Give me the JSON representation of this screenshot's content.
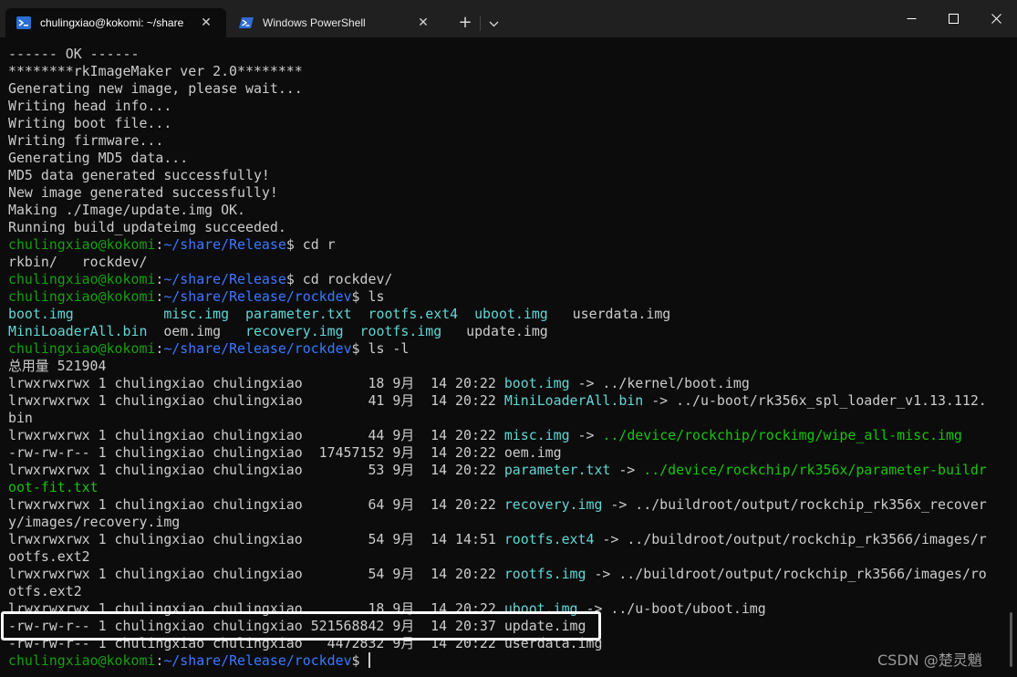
{
  "tabs": [
    {
      "label": "chulingxiao@kokomi: ~/share",
      "icon": "linux-shell-icon",
      "close": "✕"
    },
    {
      "label": "Windows PowerShell",
      "icon": "powershell-icon",
      "close": "✕"
    }
  ],
  "titlebar": {
    "new_tab": "+",
    "dropdown": "chevron-down-icon"
  },
  "window_controls": {
    "minimize": "minimize-icon",
    "maximize": "maximize-icon",
    "close": "close-icon"
  },
  "prompt": {
    "user_host": "chulingxiao@kokomi",
    "sep": ":"
  },
  "terminal": {
    "build_output": [
      "------ OK ------",
      "********rkImageMaker ver 2.0********",
      "Generating new image, please wait...",
      "Writing head info...",
      "Writing boot file...",
      "Writing firmware...",
      "Generating MD5 data...",
      "MD5 data generated successfully!",
      "New image generated successfully!",
      "Making ./Image/update.img OK.",
      "Running build_updateimg succeeded."
    ],
    "path_release": "~/share/Release",
    "path_rockdev": "~/share/Release/rockdev",
    "cmd1": "cd r",
    "completions": "rkbin/   rockdev/",
    "cmd2": "cd rockdev/",
    "cmd3": "ls",
    "ls_row1": {
      "a": "boot.img",
      "b": "misc.img",
      "c": "parameter.txt",
      "d": "rootfs.ext4",
      "e": "uboot.img",
      "f": "userdata.img"
    },
    "ls_row2": {
      "a": "MiniLoaderAll.bin",
      "b": "oem.img",
      "c": "recovery.img",
      "d": "rootfs.img",
      "e": "update.img"
    },
    "cmd4": "ls -l",
    "total": "总用量 521904",
    "ll": {
      "r1_meta": "lrwxrwxrwx 1 chulingxiao chulingxiao        18 9月  14 20:22 ",
      "r1_name": "boot.img",
      "r1_target": " -> ../kernel/boot.img",
      "r2_meta": "lrwxrwxrwx 1 chulingxiao chulingxiao        41 9月  14 20:22 ",
      "r2_name": "MiniLoaderAll.bin",
      "r2_target": " -> ../u-boot/rk356x_spl_loader_v1.13.112.",
      "r2_wrap": "bin",
      "r3_meta": "lrwxrwxrwx 1 chulingxiao chulingxiao        44 9月  14 20:22 ",
      "r3_name": "misc.img",
      "r3_arrow": " -> ",
      "r3_target": "../device/rockchip/rockimg/wipe_all-misc.img",
      "r4_meta": "-rw-rw-r-- 1 chulingxiao chulingxiao  17457152 9月  14 20:22 ",
      "r4_name": "oem.img",
      "r5_meta": "lrwxrwxrwx 1 chulingxiao chulingxiao        53 9月  14 20:22 ",
      "r5_name": "parameter.txt",
      "r5_arrow": " -> ",
      "r5_target": "../device/rockchip/rk356x/parameter-buildr",
      "r5_wrap": "oot-fit.txt",
      "r6_meta": "lrwxrwxrwx 1 chulingxiao chulingxiao        64 9月  14 20:22 ",
      "r6_name": "recovery.img",
      "r6_target": " -> ../buildroot/output/rockchip_rk356x_recover",
      "r6_wrap": "y/images/recovery.img",
      "r7_meta": "lrwxrwxrwx 1 chulingxiao chulingxiao        54 9月  14 14:51 ",
      "r7_name": "rootfs.ext4",
      "r7_target": " -> ../buildroot/output/rockchip_rk3566/images/r",
      "r7_wrap": "ootfs.ext2",
      "r8_meta": "lrwxrwxrwx 1 chulingxiao chulingxiao        54 9月  14 20:22 ",
      "r8_name": "rootfs.img",
      "r8_target": " -> ../buildroot/output/rockchip_rk3566/images/ro",
      "r8_wrap": "otfs.ext2",
      "r9_meta": "lrwxrwxrwx 1 chulingxiao chulingxiao        18 9月  14 20:22 ",
      "r9_name": "uboot.img",
      "r9_target": " -> ../u-boot/uboot.img",
      "r10_meta": "-rw-rw-r-- 1 chulingxiao chulingxiao 521568842 9月  14 20:37 ",
      "r10_name": "update.img",
      "r11_meta": "-rw-rw-r-- 1 chulingxiao chulingxiao   4472832 9月  14 20:22 ",
      "r11_name": "userdata.img"
    },
    "final_prompt_tail": "$ "
  },
  "watermark": "CSDN @楚灵魈",
  "colors": {
    "bg": "#0c0c0c",
    "text": "#cccccc",
    "user": "#13a10e",
    "path": "#3b78ff",
    "symlink": "#61d6d6",
    "link_target": "#16c60c",
    "highlight": "#ffffff"
  }
}
